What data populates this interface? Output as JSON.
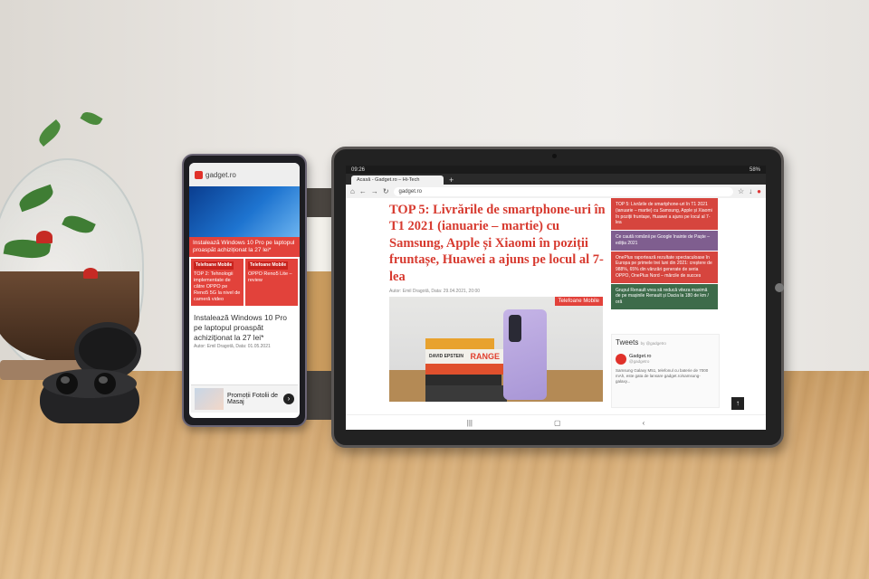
{
  "phone": {
    "site": "gadget.ro",
    "banner": "Instalează Windows 10 Pro pe laptopul proaspăt achiziționat la 27 lei*",
    "card1_label": "Telefoane Mobile",
    "card1_text": "TOP 2: Tehnologii implementate de către OPPO pe Reno5 5G la nivel de cameră video",
    "card2_label": "Telefoane Mobile",
    "card2_text": "OPPO Reno5 Lite – review",
    "article_title": "Instalează Windows 10 Pro pe laptopul proaspăt achiziționat la 27 lei*",
    "meta": "Autor: Emil Dragotă, Data: 01.05.2021",
    "ad_text": "Promoții Fotolii de Masaj"
  },
  "tablet": {
    "status_time": "09:26",
    "status_battery": "58%",
    "tab_title": "Acasă - Gadget.ro – Hi-Tech",
    "url": "gadget.ro",
    "headline": "TOP 5: Livrările de smartphone-uri în T1 2021 (ianuarie – martie) cu Samsung, Apple și Xiaomi în poziții fruntașe, Huawei a ajuns pe locul al 7-lea",
    "byline": "Autor: Emil Dragotă, Data: 29.04.2021, 20:00",
    "image_badge": "Telefoane Mobile",
    "book_label": "RANGE",
    "book_author": "DAVID EPSTEIN",
    "sidebar": [
      {
        "text": "TOP 5: Livrările de smartphone-uri în T1 2021 (ianuarie – martie) cu Samsung, Apple și Xiaomi în poziții fruntașe, Huawei a ajuns pe locul al 7-lea",
        "color": "#d6453e"
      },
      {
        "text": "Ce caută românii pe Google înainte de Paște – ediția 2021",
        "color": "#7f5e8f"
      },
      {
        "text": "OnePlus raportează rezultate spectaculoase în Europa pe primele trei luni din 2021: creștere de 988%, 65% din vânzări generate de seria OPPO, OnePlus Nord – mărcile de succes",
        "color": "#d6453e"
      },
      {
        "text": "Grupul Renault vrea să reducă viteza maximă de pe mașinile Renault și Dacia la 180 de km / oră",
        "color": "#3d6b4a"
      }
    ],
    "tweets_title": "Tweets",
    "tweets_by": "by @gadgetro",
    "tweet_account": "Gadget.ro",
    "tweet_handle": "@gadgetro",
    "tweet_text": "Samsung Galaxy M51, telefonul cu baterie de 7000 mAh, este gata de lansare gadget.ro/samsung-galaxy..."
  },
  "colors": {
    "accent_red": "#e2423b",
    "headline_red": "#d73a2f"
  }
}
